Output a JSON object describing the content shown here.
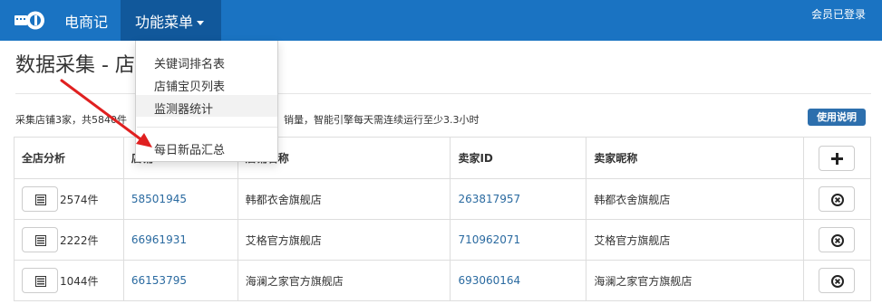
{
  "navbar": {
    "brand_name": "电商记",
    "menu_label": "功能菜单",
    "member_status": "会员已登录",
    "colors": {
      "bar": "#1a73c2",
      "active": "#11589b"
    }
  },
  "dropdown": {
    "items": [
      {
        "label": "关键词排名表"
      },
      {
        "label": "店铺宝贝列表"
      },
      {
        "label": "监测器统计"
      },
      {
        "label": "每日新品汇总"
      }
    ]
  },
  "page": {
    "title": "数据采集 - 店",
    "summary_start": "采集店铺3家，共5840件",
    "summary_end": "销量，智能引擎每天需连续运行至少3.3小时",
    "help_label": "使用说明"
  },
  "table": {
    "headers": {
      "analysis": "全店分析",
      "shop_id": "店铺ID",
      "shop_name": "店铺名称",
      "seller_id": "卖家ID",
      "seller_nick": "卖家昵称"
    },
    "rows": [
      {
        "count": "2574件",
        "shop_id": "58501945",
        "shop_name": "韩都衣舍旗舰店",
        "seller_id": "263817957",
        "seller_nick": "韩都衣舍旗舰店"
      },
      {
        "count": "2222件",
        "shop_id": "66961931",
        "shop_name": "艾格官方旗舰店",
        "seller_id": "710962071",
        "seller_nick": "艾格官方旗舰店"
      },
      {
        "count": "1044件",
        "shop_id": "66153795",
        "shop_name": "海澜之家官方旗舰店",
        "seller_id": "693060164",
        "seller_nick": "海澜之家官方旗舰店"
      }
    ]
  },
  "icons": {
    "logo": "key-logo-icon",
    "dropdown_caret": "caret-down-icon",
    "analysis": "list-icon",
    "add": "plus-icon",
    "remove": "remove-circle-icon",
    "annotation": "red-arrow-icon"
  },
  "colors": {
    "link": "#2a6aa0",
    "help_button": "#2d6fad",
    "arrow": "#e02020"
  }
}
